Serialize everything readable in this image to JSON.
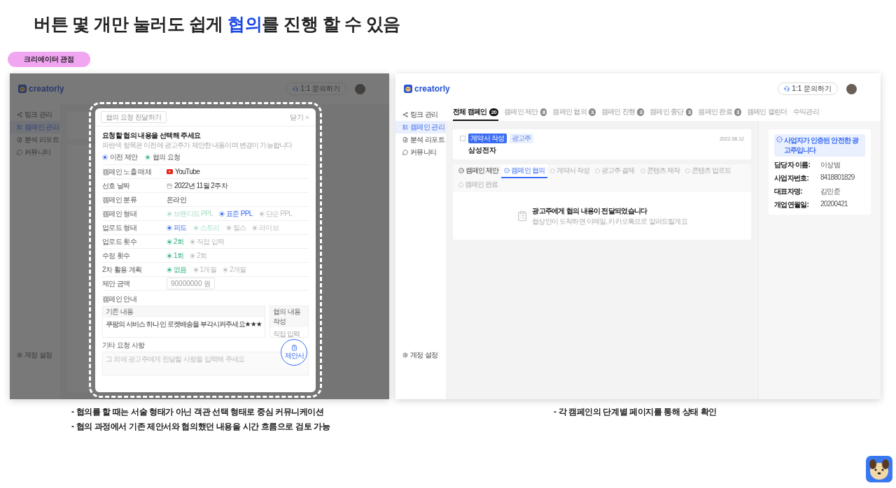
{
  "page_title": {
    "before": "버튼 몇 개만 눌러도 쉽게 ",
    "highlight": "협의",
    "after": "를 진행 할 수 있음"
  },
  "perspective_tag": "크리에이터 관점",
  "left_screen": {
    "logo": "creatorly",
    "inquiry_button": "1:1 문의하기",
    "sidebar": [
      {
        "label": "링크 관리",
        "selected": false
      },
      {
        "label": "캠페인 관리",
        "selected": true
      },
      {
        "label": "분석 리포트",
        "selected": false
      },
      {
        "label": "커뮤니티",
        "selected": false
      }
    ],
    "settings": "계정 설정",
    "modal": {
      "send_button": "협의 요청 전달하기",
      "close_button": "닫기",
      "title": "요청할 협의 내용을 선택해 주세요",
      "subtitle": "파란색 항목은 이전에 광고주가 제안한 내용이며 변경이 가능합니다",
      "legend": [
        {
          "label": "이전 제안",
          "kind": "proposal"
        },
        {
          "label": "협의 요청",
          "kind": "request"
        }
      ],
      "rows": [
        {
          "label": "캠페인 노출 매체",
          "kind": "media",
          "value": "YouTube"
        },
        {
          "label": "선호 날짜",
          "kind": "date",
          "value": "2022년 11월 2주차"
        },
        {
          "label": "캠페인 분류",
          "kind": "text",
          "value": "온라인"
        },
        {
          "label": "캠페인 형태",
          "kind": "options",
          "options": [
            {
              "label": "브랜디드 PPL",
              "kind": "request",
              "selected": false
            },
            {
              "label": "표준 PPL",
              "kind": "proposal",
              "selected": true
            },
            {
              "label": "단순 PPL",
              "kind": "plain",
              "selected": false
            }
          ]
        },
        {
          "label": "업로드 형태",
          "kind": "options",
          "options": [
            {
              "label": "피드",
              "kind": "proposal",
              "selected": true
            },
            {
              "label": "스토리",
              "kind": "request",
              "selected": false
            },
            {
              "label": "릴스",
              "kind": "plain",
              "selected": false
            },
            {
              "label": "라이브",
              "kind": "plain",
              "selected": false
            }
          ]
        },
        {
          "label": "업로드 횟수",
          "kind": "options",
          "options": [
            {
              "label": "2회",
              "kind": "request",
              "selected": true
            },
            {
              "label": "직접 입력",
              "kind": "plain",
              "selected": false
            }
          ]
        },
        {
          "label": "수정 횟수",
          "kind": "options",
          "options": [
            {
              "label": "1회",
              "kind": "request",
              "selected": true
            },
            {
              "label": "2회",
              "kind": "plain",
              "selected": false
            }
          ]
        },
        {
          "label": "2차 활용 계획",
          "kind": "options",
          "options": [
            {
              "label": "없음",
              "kind": "request",
              "selected": true
            },
            {
              "label": "1개월",
              "kind": "plain",
              "selected": false
            },
            {
              "label": "2개월",
              "kind": "plain",
              "selected": false
            }
          ]
        },
        {
          "label": "제안 금액",
          "kind": "amount",
          "placeholder": "90000000 원"
        }
      ],
      "guide": {
        "title": "캠페인 안내",
        "existing_label": "기존 내용",
        "existing_text": "쿠팡의 서비스 하나인 로켓배송을 부각시켜주세요★★★",
        "request_label": "협의 내용 작성",
        "request_placeholder": "직접 입력"
      },
      "other": {
        "label": "기타 요청 사항",
        "placeholder": "그 외에 광고주에게 전달할 사항을 입력해 주세요"
      },
      "proposal_button": "제안서"
    }
  },
  "right_screen": {
    "logo": "creatorly",
    "inquiry_button": "1:1 문의하기",
    "sidebar": [
      {
        "label": "링크 관리",
        "selected": false
      },
      {
        "label": "캠페인 관리",
        "selected": true
      },
      {
        "label": "분석 리포트",
        "selected": false
      },
      {
        "label": "커뮤니티",
        "selected": false
      }
    ],
    "settings": "계정 설정",
    "tabs": [
      {
        "label": "전체 캠페인",
        "count": "20",
        "selected": true
      },
      {
        "label": "캠페인 제안",
        "count": "8",
        "selected": false
      },
      {
        "label": "캠페인 협의",
        "count": "3",
        "selected": false
      },
      {
        "label": "캠페인 진행",
        "count": "3",
        "selected": false
      },
      {
        "label": "캠페인 중단",
        "count": "3",
        "selected": false
      },
      {
        "label": "캠페인 완료",
        "count": "3",
        "selected": false
      },
      {
        "label": "캠페인 캘린더",
        "selected": false
      },
      {
        "label": "수익관리",
        "selected": false
      }
    ],
    "campaign": {
      "checked": false,
      "status": "계약서 작성",
      "role": "광고주",
      "name": "삼성전자",
      "date": "2022.08.12"
    },
    "steps": [
      {
        "label": "캠페인 제안",
        "done": true,
        "selected": false
      },
      {
        "label": "캠페인 협의",
        "done": true,
        "selected": true
      },
      {
        "label": "계약서 작성",
        "done": false,
        "selected": false
      },
      {
        "label": "광고주 결제",
        "done": false,
        "selected": false
      },
      {
        "label": "콘텐츠 제작",
        "done": false,
        "selected": false
      },
      {
        "label": "콘텐츠 업로드",
        "done": false,
        "selected": false
      },
      {
        "label": "캠페인 완료",
        "done": false,
        "selected": false
      }
    ],
    "empty_state": {
      "title": "광고주에게 협의 내용이 전달되었습니다",
      "description": "협상안이 도착하면 이메일, 카카오톡으로 알려드릴게요"
    },
    "advertiser": {
      "verified": "사업자가 인증된 안전한 광고주입니다",
      "fields": [
        {
          "label": "담당자 이름:",
          "value": "이상범"
        },
        {
          "label": "사업자번호:",
          "value": "8418801829"
        },
        {
          "label": "대표자명:",
          "value": "김민준"
        },
        {
          "label": "개업연월일:",
          "value": "20200421"
        }
      ]
    }
  },
  "captions_left": [
    "- 협의를 할 때는 서술 형태가 아닌 객관 선택 형태로 중심 커뮤니케이션",
    "- 협의 과정에서 기존 제안서와 협의했던 내용을 시간 흐름으로 검토 가능"
  ],
  "caption_right": "- 각 캠페인의 단계별 페이지를 통해 상태 확인"
}
